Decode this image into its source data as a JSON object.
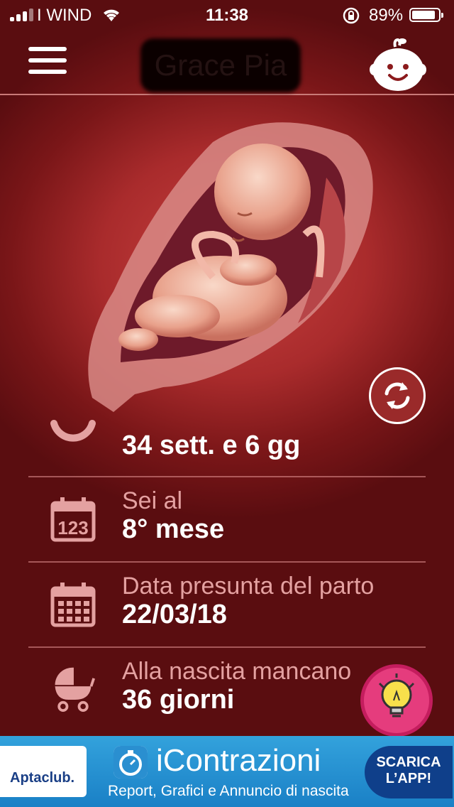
{
  "status_bar": {
    "carrier": "I WIND",
    "time": "11:38",
    "battery": "89%",
    "battery_level": 0.89
  },
  "header": {
    "baby_name": "Grace Pia"
  },
  "info": {
    "weeks_value": "34 sett. e 6 gg",
    "month_label": "Sei al",
    "month_value": "8° mese",
    "due_label": "Data presunta del parto",
    "due_value": "22/03/18",
    "countdown_label": "Alla nascita mancano",
    "countdown_value": "36 giorni"
  },
  "calendar_icon_text": "123",
  "banner": {
    "brand": "Aptaclub.",
    "app_name": "iContrazioni",
    "subtitle": "Report, Grafici e Annuncio di nascita",
    "cta": "SCARICA\nL’APP!"
  },
  "colors": {
    "background": "#a92b2c",
    "accent_pink": "#e53c7d",
    "banner_blue": "#1a80c6"
  },
  "icons": [
    "menu-icon",
    "baby-face-icon",
    "refresh-icon",
    "weeks-arc-icon",
    "calendar-number-icon",
    "calendar-grid-icon",
    "pram-icon",
    "lightbulb-icon",
    "stopwatch-icon",
    "signal-icon",
    "wifi-icon",
    "lock-rotation-icon",
    "battery-icon"
  ]
}
